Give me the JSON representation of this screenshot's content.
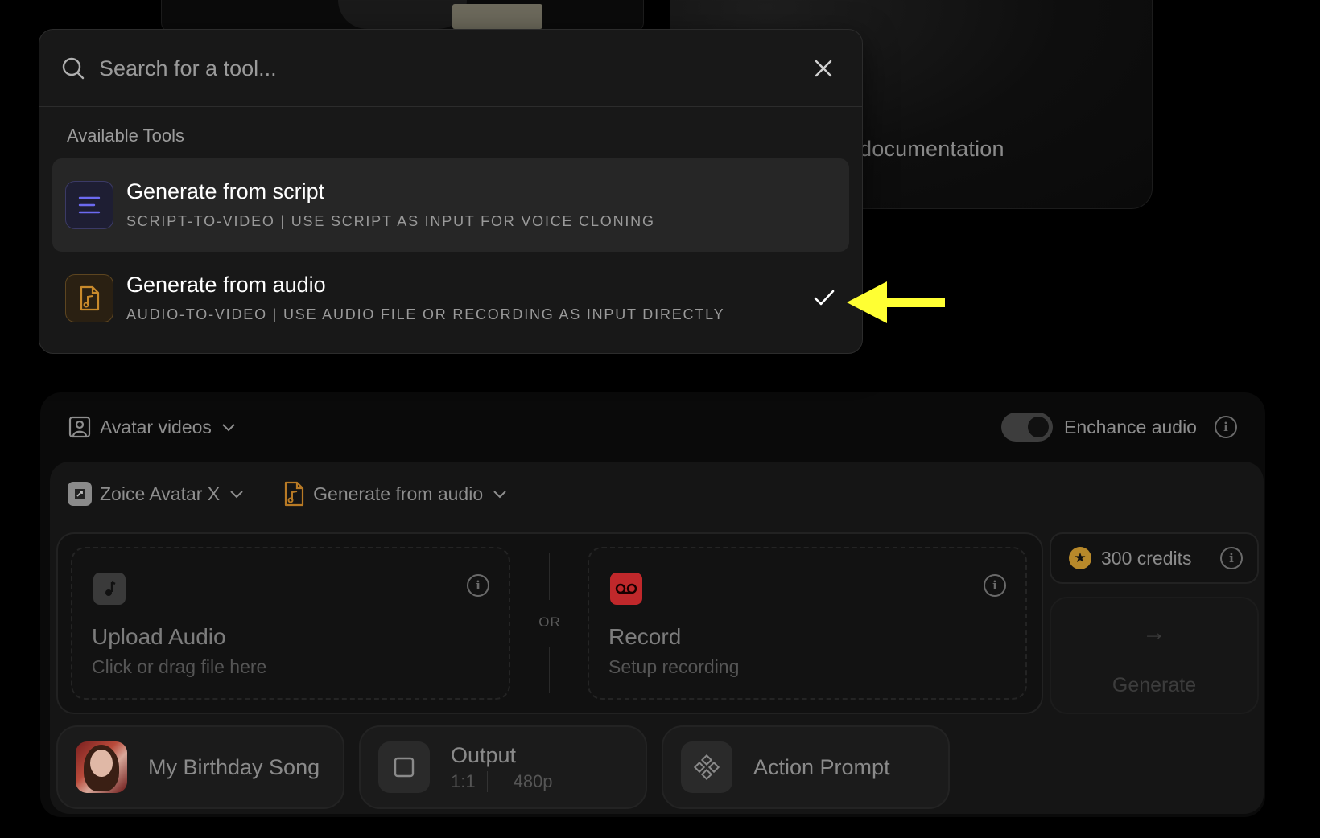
{
  "background": {
    "documentation_text": "documentation"
  },
  "popup": {
    "search": {
      "placeholder": "Search for a tool...",
      "value": ""
    },
    "section_label": "Available Tools",
    "tools": [
      {
        "title": "Generate from script",
        "subtitle": "SCRIPT-TO-VIDEO | USE SCRIPT AS INPUT FOR VOICE CLONING",
        "icon": "text-lines-icon",
        "accent": "#6c6af0",
        "highlighted": true,
        "selected": false
      },
      {
        "title": "Generate from audio",
        "subtitle": "AUDIO-TO-VIDEO | USE AUDIO FILE OR RECORDING AS INPUT DIRECTLY",
        "icon": "audio-file-icon",
        "accent": "#c98a2b",
        "highlighted": false,
        "selected": true
      }
    ]
  },
  "composer": {
    "mode_label": "Avatar videos",
    "enhance_audio": {
      "label": "Enchance audio",
      "enabled": true
    },
    "avatar_model": "Zoice Avatar X",
    "tool_selected": "Generate from audio",
    "upload": {
      "title": "Upload Audio",
      "subtitle": "Click or drag file here"
    },
    "divider_text": "OR",
    "record": {
      "title": "Record",
      "subtitle": "Setup recording"
    },
    "credits": "300 credits",
    "generate_label": "Generate",
    "chips": {
      "song": "My Birthday Song",
      "output_label": "Output",
      "output_ratio": "1:1",
      "output_resolution": "480p",
      "action_prompt": "Action Prompt"
    }
  },
  "colors": {
    "pointer_arrow": "#ffff33",
    "record_accent": "#c0282b",
    "credits_star": "#b8892a"
  }
}
